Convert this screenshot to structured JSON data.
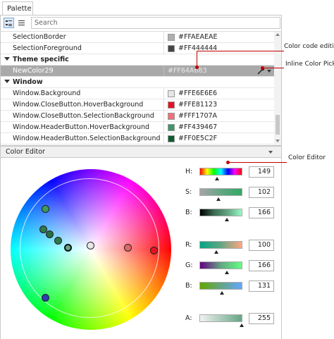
{
  "tab": {
    "label": "Palette"
  },
  "search": {
    "placeholder": "Search"
  },
  "rows": [
    {
      "name": "SelectionBorder",
      "color": "#AEAEAE",
      "value": "#FFAEAEAE"
    },
    {
      "name": "SelectionForeground",
      "color": "#444444",
      "value": "#FF444444"
    }
  ],
  "group_theme": {
    "label": "Theme specific"
  },
  "selected_row": {
    "name": "NewColor29",
    "value": "#FF64A683"
  },
  "group_window": {
    "label": "Window"
  },
  "window_rows": [
    {
      "name": "Window.Background",
      "color": "#E6E6E6",
      "value": "#FFE6E6E6"
    },
    {
      "name": "Window.CloseButton.HoverBackground",
      "color": "#E81123",
      "value": "#FFE81123"
    },
    {
      "name": "Window.CloseButton.SelectionBackground",
      "color": "#F1707A",
      "value": "#FFF1707A"
    },
    {
      "name": "Window.HeaderButton.HoverBackground",
      "color": "#439467",
      "value": "#FF439467"
    },
    {
      "name": "Window.HeaderButton.SelectionBackground",
      "color": "#0E5C2F",
      "value": "#FF0E5C2F"
    }
  ],
  "color_editor": {
    "title": "Color Editor",
    "h": {
      "label": "H:",
      "value": "149"
    },
    "s": {
      "label": "S:",
      "value": "102"
    },
    "b1": {
      "label": "B:",
      "value": "166"
    },
    "r": {
      "label": "R:",
      "value": "100"
    },
    "g": {
      "label": "G:",
      "value": "166"
    },
    "b2": {
      "label": "B:",
      "value": "131"
    },
    "a": {
      "label": "A:",
      "value": "255"
    }
  },
  "callouts": {
    "code": "Color code editing",
    "picker": "Inline Color Picker",
    "editor": "Color Editor"
  }
}
